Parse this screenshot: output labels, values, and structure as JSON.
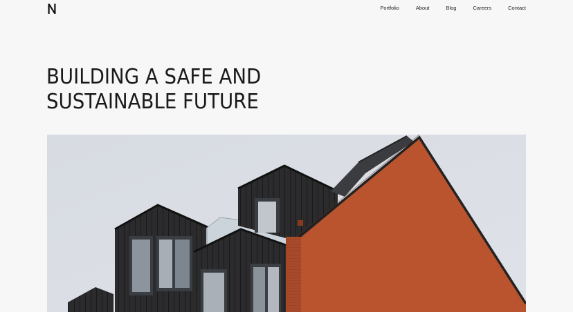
{
  "brand": {
    "logo_letter": "N",
    "logo_icon": "n-monogram-logo"
  },
  "nav": {
    "items": [
      {
        "label": "Portfolio"
      },
      {
        "label": "About"
      },
      {
        "label": "Blog"
      },
      {
        "label": "Careers"
      },
      {
        "label": "Contact"
      }
    ]
  },
  "hero": {
    "title_line_1": "BUILDING A SAFE AND",
    "title_line_2": "SUSTAINABLE FUTURE",
    "image_subject": "modern-building-photo"
  },
  "colors": {
    "background": "#f7f7f8",
    "text": "#1a1a1a",
    "sky": "#d3d8e0",
    "brick": "#b8532d",
    "dark_cladding": "#2c2c2e"
  }
}
